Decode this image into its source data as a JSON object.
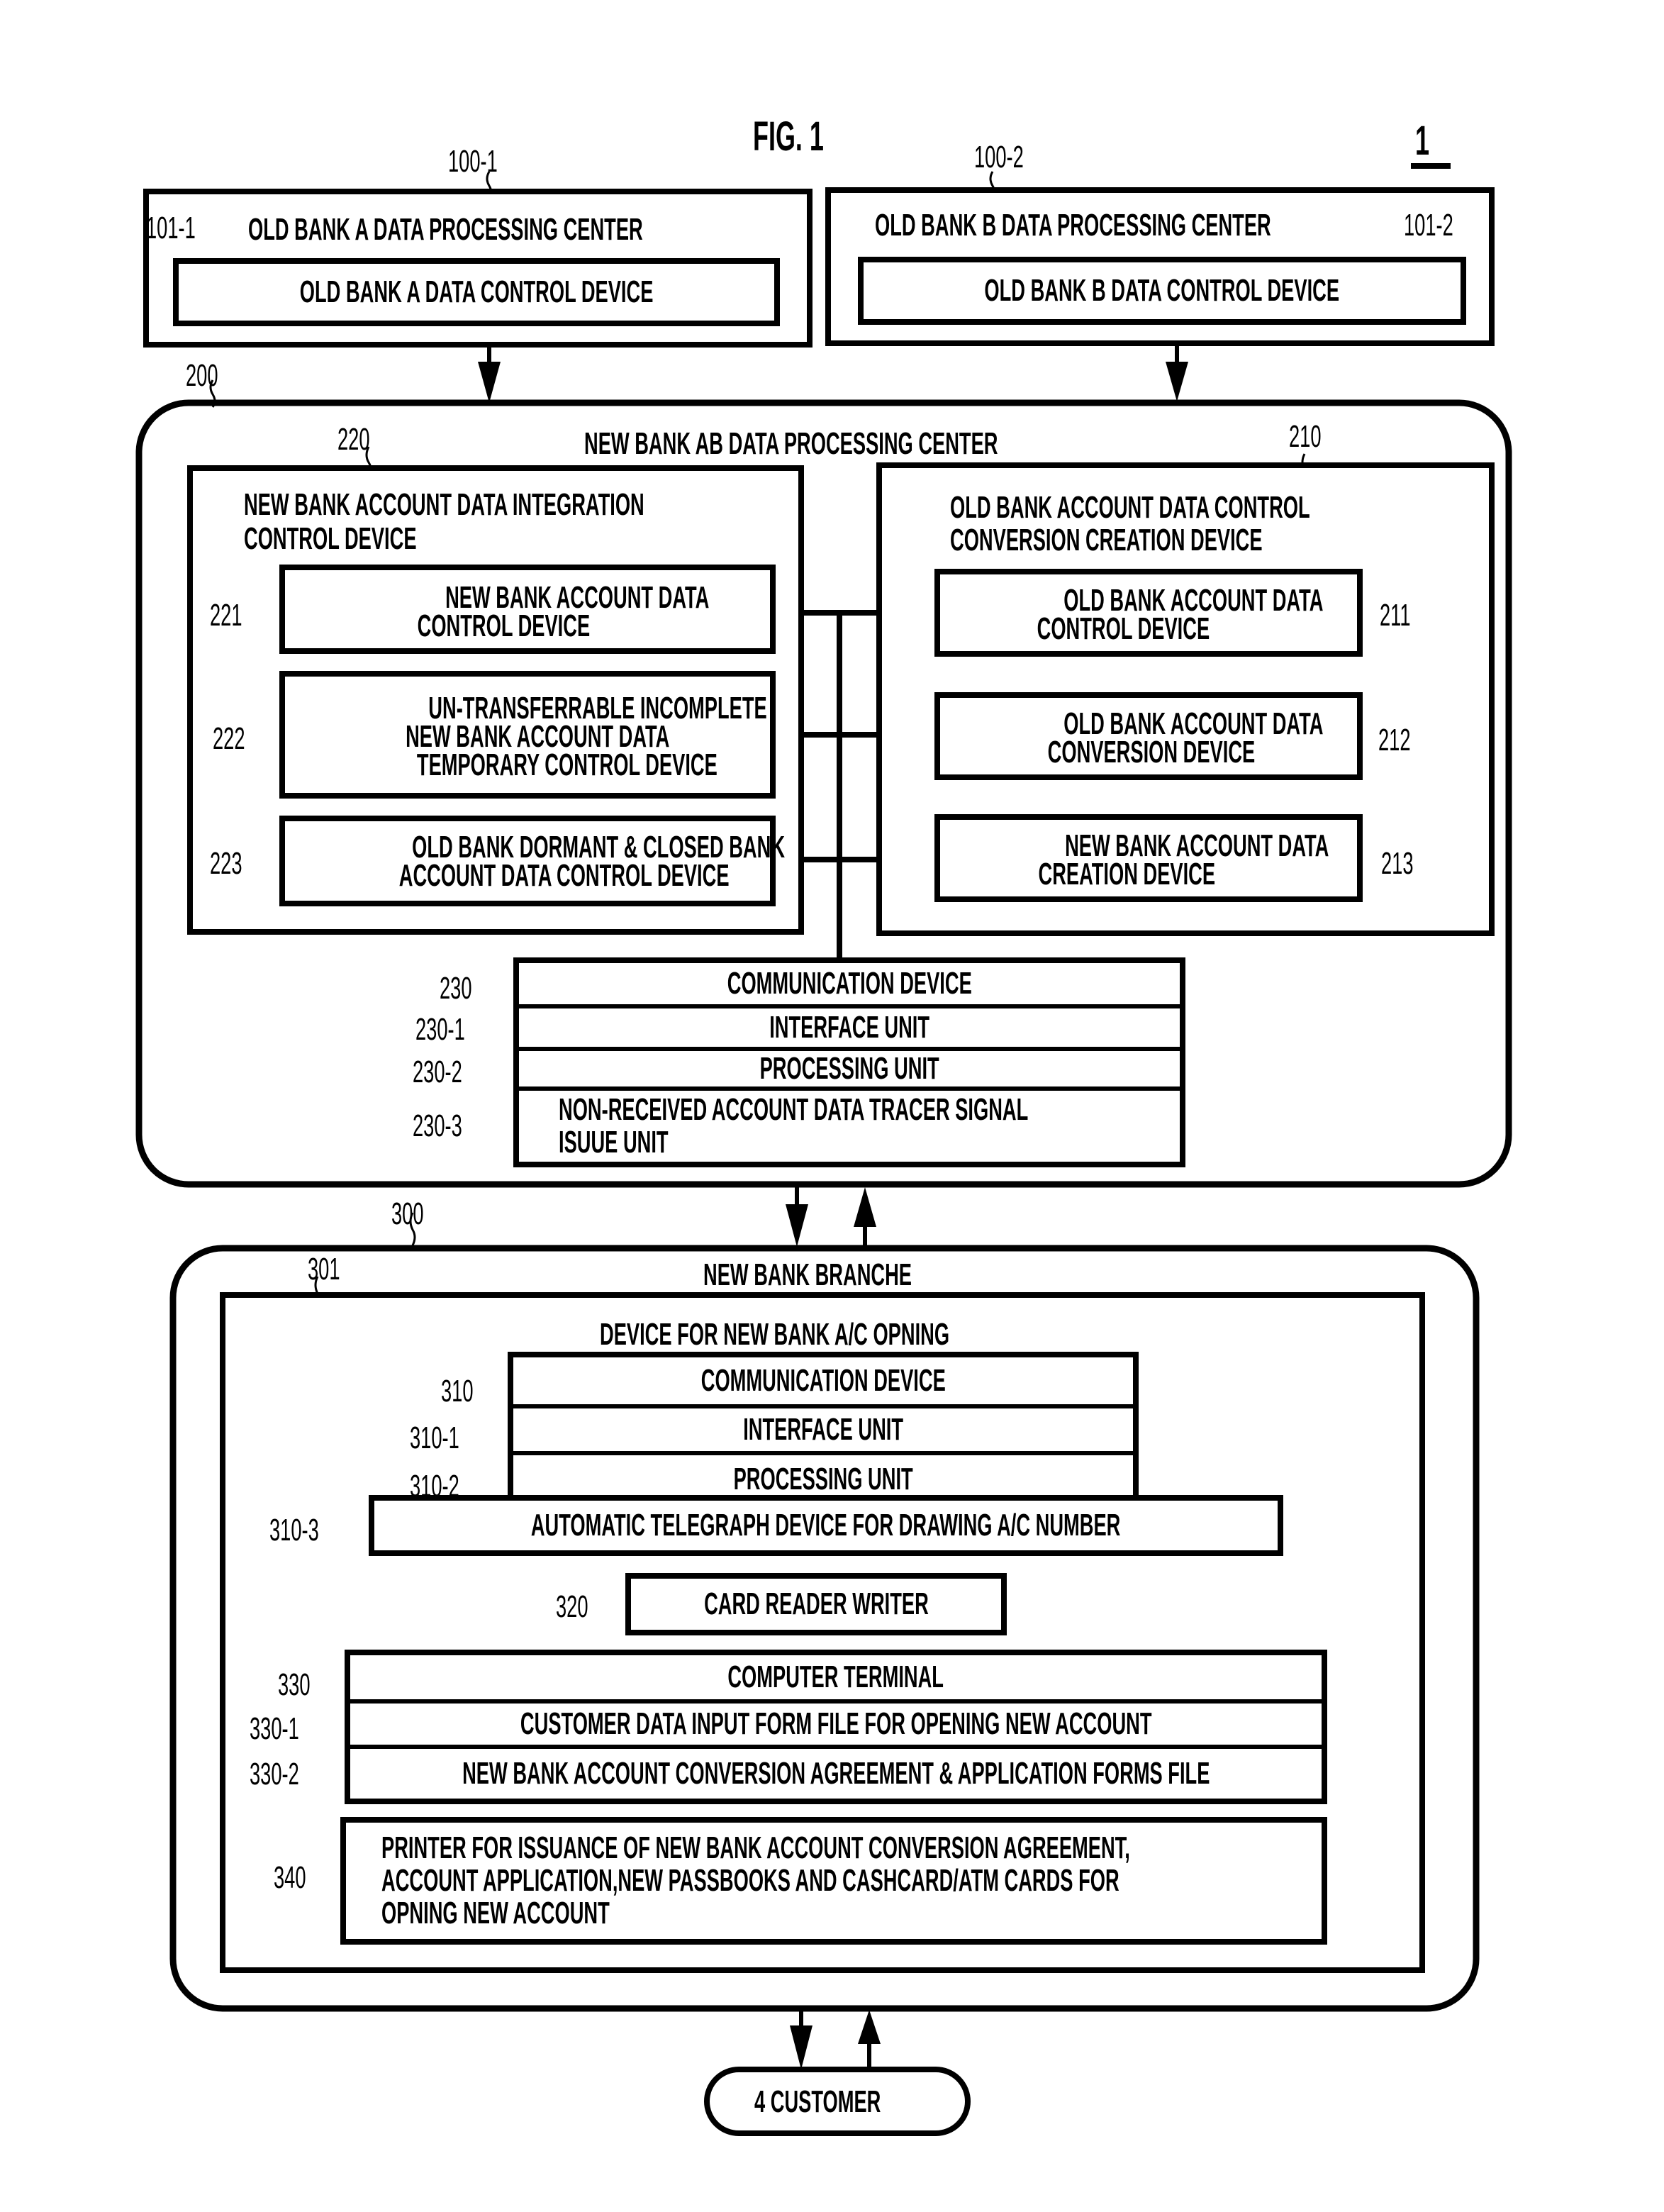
{
  "figure": {
    "title": "FIG. 1",
    "system_ref": "1"
  },
  "old_bank_a": {
    "ref": "100-1",
    "title": "OLD BANK A DATA PROCESSING CENTER",
    "device_ref": "101-1",
    "device_label": "OLD BANK A DATA CONTROL DEVICE"
  },
  "old_bank_b": {
    "ref": "100-2",
    "title": "OLD BANK B DATA PROCESSING CENTER",
    "device_ref": "101-2",
    "device_label": "OLD BANK B DATA CONTROL DEVICE"
  },
  "new_center": {
    "ref": "200",
    "title": "NEW BANK AB DATA PROCESSING CENTER",
    "integration": {
      "ref": "220",
      "title_line1": "NEW BANK ACCOUNT DATA INTEGRATION",
      "title_line2": "CONTROL DEVICE",
      "devices": [
        {
          "ref": "221",
          "lines": [
            "NEW BANK ACCOUNT DATA",
            "CONTROL DEVICE"
          ]
        },
        {
          "ref": "222",
          "lines": [
            "UN-TRANSFERRABLE INCOMPLETE",
            "NEW BANK ACCOUNT DATA",
            "TEMPORARY CONTROL DEVICE"
          ]
        },
        {
          "ref": "223",
          "lines": [
            "OLD BANK DORMANT & CLOSED BANK",
            "ACCOUNT DATA CONTROL DEVICE"
          ]
        }
      ]
    },
    "conversion": {
      "ref": "210",
      "title_line1": "OLD BANK ACCOUNT DATA CONTROL",
      "title_line2": "CONVERSION CREATION DEVICE",
      "devices": [
        {
          "ref": "211",
          "lines": [
            "OLD BANK ACCOUNT DATA",
            "CONTROL DEVICE"
          ]
        },
        {
          "ref": "212",
          "lines": [
            "OLD BANK ACCOUNT DATA",
            "CONVERSION DEVICE"
          ]
        },
        {
          "ref": "213",
          "lines": [
            "NEW BANK ACCOUNT DATA",
            "CREATION DEVICE"
          ]
        }
      ]
    },
    "communication": {
      "rows": [
        {
          "ref": "230",
          "label": "COMMUNICATION DEVICE"
        },
        {
          "ref": "230-1",
          "label": "INTERFACE UNIT"
        },
        {
          "ref": "230-2",
          "label": "PROCESSING UNIT"
        },
        {
          "ref": "230-3",
          "label": "NON-RECEIVED ACCOUNT DATA TRACER SIGNAL\nISUUE UNIT"
        }
      ]
    }
  },
  "branch": {
    "ref": "300",
    "title": "NEW BANK BRANCHE",
    "device": {
      "ref": "301",
      "title": "DEVICE FOR NEW BANK A/C OPNING",
      "communication_rows": [
        {
          "ref": "310",
          "label": "COMMUNICATION DEVICE"
        },
        {
          "ref": "310-1",
          "label": "INTERFACE UNIT"
        },
        {
          "ref": "310-2",
          "label": "PROCESSING UNIT"
        }
      ],
      "telegraph": {
        "ref": "310-3",
        "label": "AUTOMATIC TELEGRAPH DEVICE FOR DRAWING A/C NUMBER"
      },
      "card_reader": {
        "ref": "320",
        "label": "CARD READER WRITER"
      },
      "terminal_rows": [
        {
          "ref": "330",
          "label": "COMPUTER TERMINAL"
        },
        {
          "ref": "330-1",
          "label": "CUSTOMER DATA INPUT FORM FILE FOR OPENING NEW ACCOUNT"
        },
        {
          "ref": "330-2",
          "label": "NEW BANK ACCOUNT CONVERSION AGREEMENT & APPLICATION FORMS FILE"
        }
      ],
      "printer": {
        "ref": "340",
        "label": "PRINTER FOR ISSUANCE OF NEW BANK ACCOUNT CONVERSION AGREEMENT,\nACCOUNT APPLICATION,NEW PASSBOOKS AND CASHCARD/ATM CARDS FOR\nOPNING NEW ACCOUNT"
      }
    }
  },
  "customer": {
    "label": "4 CUSTOMER"
  }
}
